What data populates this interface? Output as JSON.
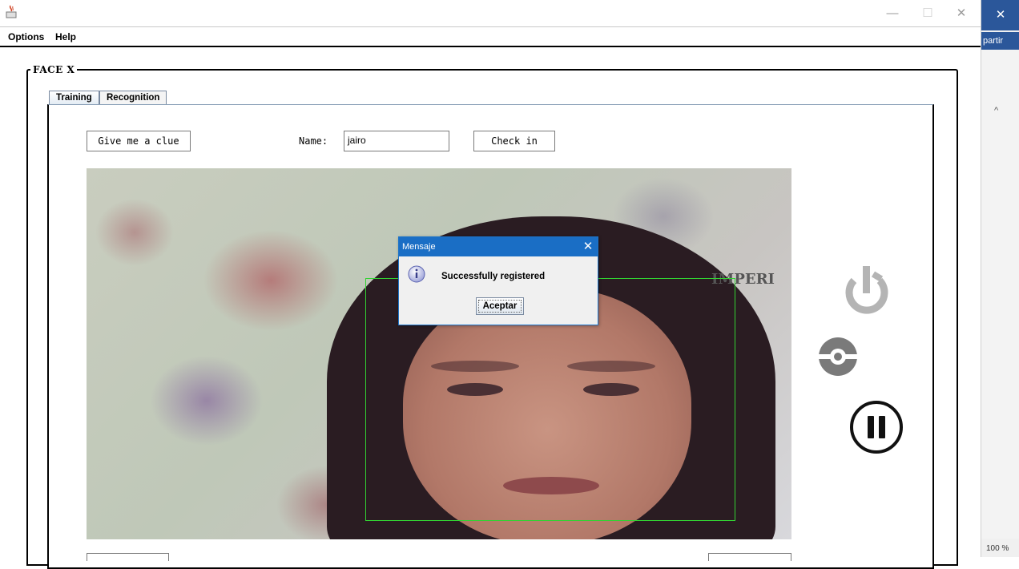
{
  "window": {
    "minimize_glyph": "—",
    "maximize_glyph": "☐",
    "close_glyph": "✕"
  },
  "menu": {
    "options": "Options",
    "help": "Help"
  },
  "side_window": {
    "close_glyph": "✕",
    "label": "partir",
    "zoom": "100 %",
    "chevron": "^"
  },
  "group": {
    "title": "FACE X"
  },
  "tabs": [
    {
      "label": "Training",
      "selected": true
    },
    {
      "label": "Recognition",
      "selected": false
    }
  ],
  "training": {
    "clue_button": "Give me a clue",
    "name_label": "Name:",
    "name_value": "jairo",
    "checkin_button": "Check in",
    "wall_text": "IMPERI"
  },
  "icons": {
    "power": "power-icon",
    "record": "record-icon",
    "pause": "pause-icon",
    "info": "info-icon",
    "java": "java-app-icon"
  },
  "colors": {
    "face_box": "#32d232",
    "dialog_title_bar": "#1a6ec5",
    "icon_gray": "#b4b4b4"
  },
  "dialog": {
    "title": "Mensaje",
    "message": "Successfully registered",
    "ok_button": "Aceptar",
    "close_glyph": "✕"
  }
}
